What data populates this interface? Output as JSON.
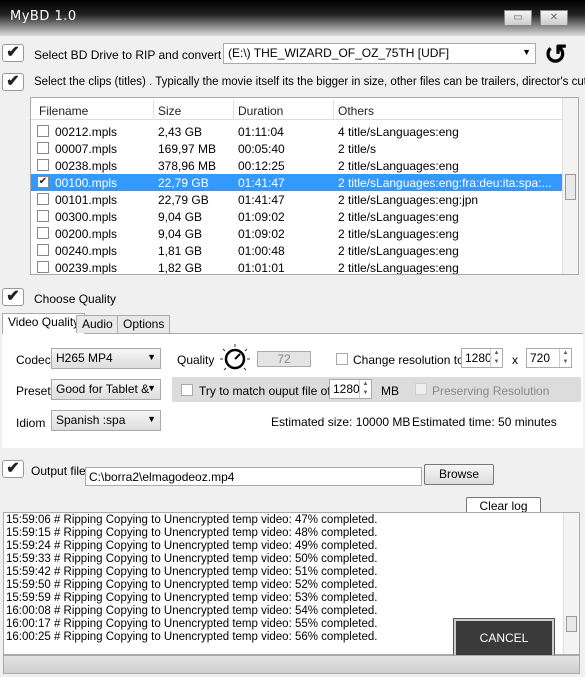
{
  "window": {
    "title": "MyBD 1.0",
    "minimize_icon": "minimize-icon",
    "close_icon": "close-icon"
  },
  "drive": {
    "label": "Select BD Drive to RIP and convert to",
    "value": "(E:\\) THE_WIZARD_OF_OZ_75TH [UDF]",
    "checked": true
  },
  "clips": {
    "label": "Select the clips (titles) . Typically the movie itself its the bigger in size, other files can be trailers, director's cut ..",
    "checked": true
  },
  "table": {
    "headers": [
      "Filename",
      "Size",
      "Duration",
      "Others"
    ],
    "rows": [
      {
        "checked": false,
        "filename": "00212.mpls",
        "size": "2,43 GB",
        "duration": "01:11:04",
        "others": "4 title/sLanguages:eng"
      },
      {
        "checked": false,
        "filename": "00007.mpls",
        "size": "169,97 MB",
        "duration": "00:05:40",
        "others": "2 title/s"
      },
      {
        "checked": false,
        "filename": "00238.mpls",
        "size": "378,96 MB",
        "duration": "00:12:25",
        "others": "2 title/sLanguages:eng"
      },
      {
        "checked": true,
        "selected": true,
        "filename": "00100.mpls",
        "size": "22,79 GB",
        "duration": "01:41:47",
        "others": "2 title/sLanguages:eng:fra:deu:ita:spa:..."
      },
      {
        "checked": false,
        "filename": "00101.mpls",
        "size": "22,79 GB",
        "duration": "01:41:47",
        "others": "2 title/sLanguages:eng:jpn"
      },
      {
        "checked": false,
        "filename": "00300.mpls",
        "size": "9,04 GB",
        "duration": "01:09:02",
        "others": "2 title/sLanguages:eng"
      },
      {
        "checked": false,
        "filename": "00200.mpls",
        "size": "9,04 GB",
        "duration": "01:09:02",
        "others": "2 title/sLanguages:eng"
      },
      {
        "checked": false,
        "filename": "00240.mpls",
        "size": "1,81 GB",
        "duration": "01:00:48",
        "others": "2 title/sLanguages:eng"
      },
      {
        "checked": false,
        "filename": "00239.mpls",
        "size": "1,82 GB",
        "duration": "01:01:01",
        "others": "2 title/sLanguages:eng"
      }
    ]
  },
  "quality": {
    "label": "Choose Quality",
    "checked": true,
    "tabs": [
      "Video Quality",
      "Audio",
      "Options"
    ],
    "codec_label": "Codec",
    "codec": "H265 MP4",
    "preset_label": "Preset",
    "preset": "Good for Tablet &",
    "idiom_label": "Idiom",
    "idiom": "Spanish :spa",
    "quality_label": "Quality",
    "quality_value": "72",
    "change_res_label": "Change resolution to",
    "res_w": "1280",
    "res_x": "x",
    "res_h": "720",
    "match_label": "Try to match ouput file of",
    "match_value": "1280",
    "match_unit": "MB",
    "preserve_label": "Preserving Resolution",
    "est_size": "Estimated size:  10000 MB",
    "est_time": "Estimated time:  50 minutes"
  },
  "output": {
    "label": "Output file",
    "value": "C:\\borra2\\elmagodeoz.mp4",
    "browse": "Browse",
    "checked": true
  },
  "log": {
    "clear": "Clear log",
    "lines": [
      "15:59:06 # Ripping Copying to Unencrypted temp video: 47% completed.",
      "15:59:15 # Ripping Copying to Unencrypted temp video: 48% completed.",
      "15:59:24 # Ripping Copying to Unencrypted temp video: 49% completed.",
      "15:59:33 # Ripping Copying to Unencrypted temp video: 50% completed.",
      "15:59:42 # Ripping Copying to Unencrypted temp video: 51% completed.",
      "15:59:50 # Ripping Copying to Unencrypted temp video: 52% completed.",
      "15:59:59 # Ripping Copying to Unencrypted temp video: 53% completed.",
      "16:00:08 # Ripping Copying to Unencrypted temp video: 54% completed.",
      "16:00:17 # Ripping Copying to Unencrypted temp video: 55% completed.",
      "16:00:25 # Ripping Copying to Unencrypted temp video: 56% completed."
    ]
  },
  "cancel": "CANCEL",
  "progress": 0
}
